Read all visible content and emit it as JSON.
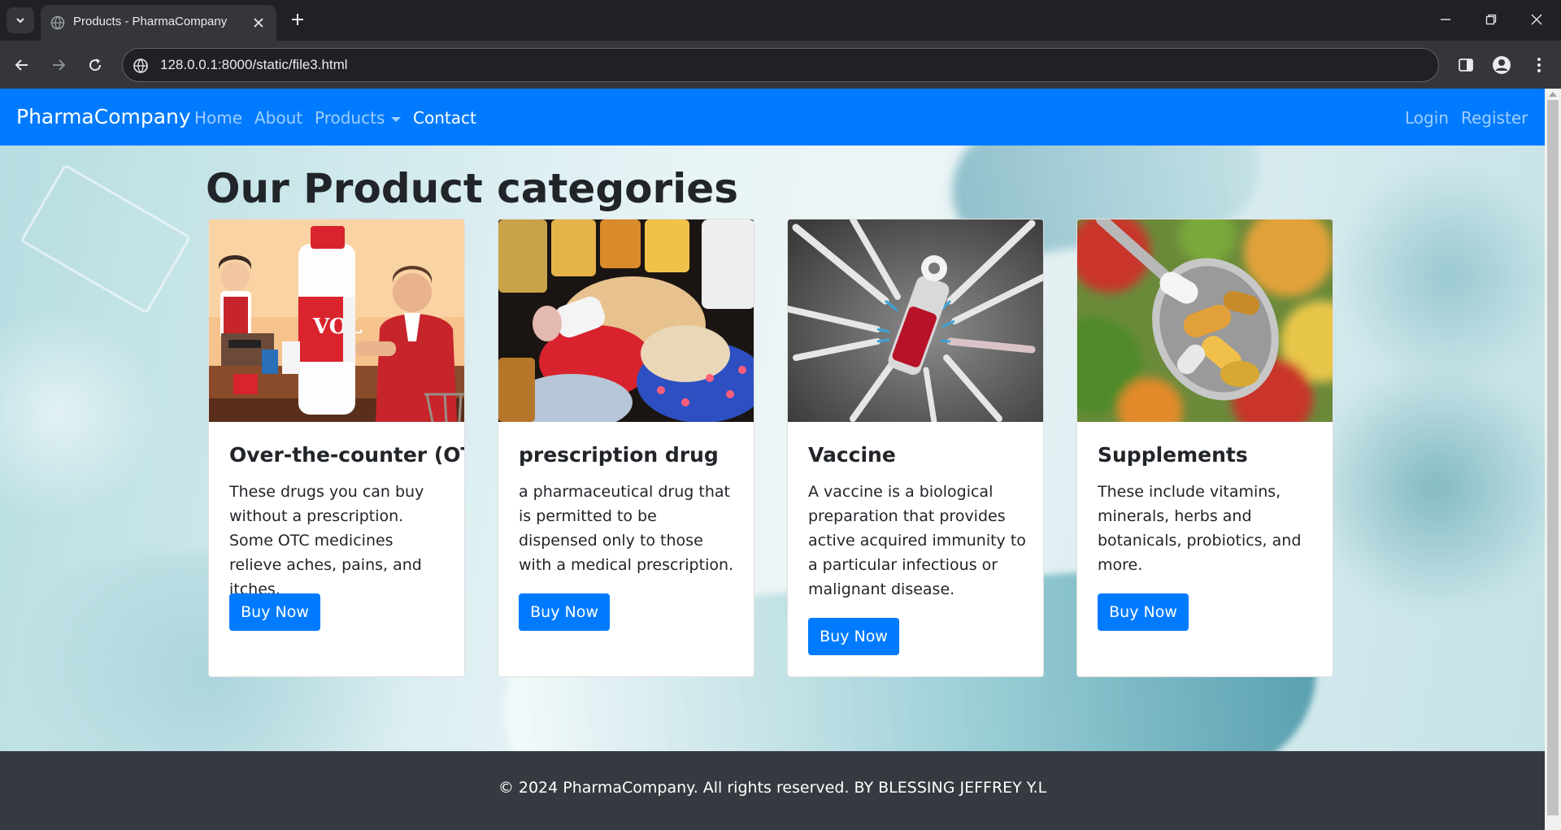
{
  "browser": {
    "tab_title": "Products - PharmaCompany",
    "url": "128.0.0.1:8000/static/file3.html"
  },
  "navbar": {
    "brand": "PharmaCompany",
    "links": [
      "Home",
      "About",
      "Products",
      "Contact"
    ],
    "right_links": [
      "Login",
      "Register"
    ],
    "accent_color": "#007bff"
  },
  "main": {
    "title": "Our Product categories",
    "cards": [
      {
        "title": "Over-the-counter (OTC)",
        "text": "These drugs you can buy without a prescription. Some OTC medicines relieve aches, pains, and itches.",
        "button": "Buy Now",
        "image": "pharmacy-counter-illustration"
      },
      {
        "title": "prescription drug",
        "text": "a pharmaceutical drug that is permitted to be dispensed only to those with a medical prescription.",
        "button": "Buy Now",
        "image": "spilled-pills-photo"
      },
      {
        "title": "Vaccine",
        "text": "A vaccine is a biological preparation that provides active acquired immunity to a particular infectious or malignant disease.",
        "button": "Buy Now",
        "image": "syringes-vial-photo"
      },
      {
        "title": "Supplements",
        "text": "These include vitamins, minerals, herbs and botanicals, probiotics, and more.",
        "button": "Buy Now",
        "image": "supplements-spoon-photo"
      }
    ]
  },
  "footer": {
    "text": "© 2024 PharmaCompany. All rights reserved. BY BLESSING JEFFREY Y.L"
  }
}
